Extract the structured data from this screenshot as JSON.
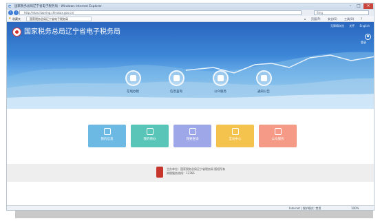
{
  "browser": {
    "title": "国家税务总局辽宁省电子税务局 - Windows Internet Explorer",
    "window_controls": {
      "minimize": "–",
      "maximize": "□",
      "close": "×"
    },
    "address": "http://etax.liaoning.chinatax.gov.cn/",
    "search_placeholder": "Bing",
    "favorites_label": "收藏夹",
    "tab_label": "国家税务总局辽宁省电子税务局",
    "commands": {
      "home": "⌂",
      "page": "页面(P)",
      "safety": "安全(S)",
      "tools": "工具(O)",
      "help": "?"
    },
    "status": "Internet | 保护模式: 禁用",
    "zoom": "100%"
  },
  "header": {
    "site_title": "国家税务总局辽宁省电子税务局",
    "top_links": [
      "无障碍浏览",
      "关怀",
      "English"
    ],
    "login_label": "登录"
  },
  "services": [
    {
      "label": "在线办税",
      "icon": "document-icon"
    },
    {
      "label": "信息查询",
      "icon": "search-card-icon"
    },
    {
      "label": "公众服务",
      "icon": "grid-icon"
    },
    {
      "label": "通知公告",
      "icon": "bell-icon"
    }
  ],
  "tiles": [
    {
      "label": "我的信息",
      "color": "#6cb9e4",
      "icon": "user-icon"
    },
    {
      "label": "我的待办",
      "color": "#59c5b9",
      "icon": "monitor-icon"
    },
    {
      "label": "我要查询",
      "color": "#9ea7e8",
      "icon": "search-doc-icon"
    },
    {
      "label": "互动中心",
      "color": "#f4c34e",
      "icon": "chat-icon"
    },
    {
      "label": "公众服务",
      "color": "#f49a86",
      "icon": "service-icon"
    }
  ],
  "footer": {
    "line1": "主办单位：国家税务总局辽宁省税务局 版权所有",
    "line2": "纳税服务热线：12366"
  },
  "colors": {
    "hero_top": "#2a66be",
    "footer_bg": "#eeeeee"
  }
}
